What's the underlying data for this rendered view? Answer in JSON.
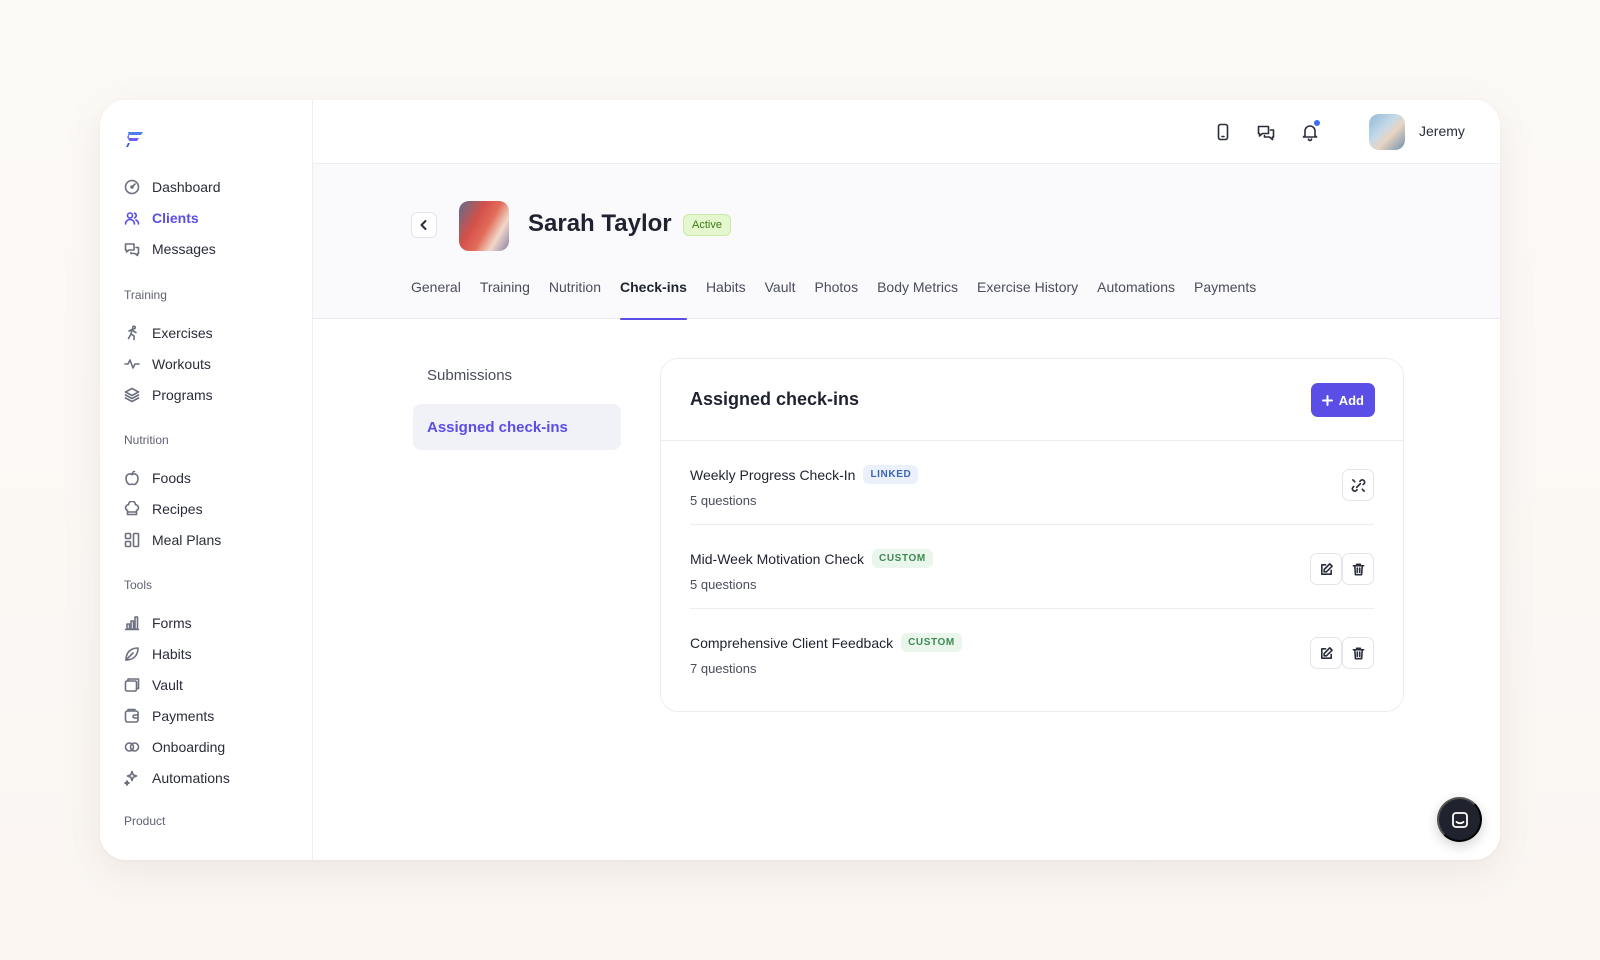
{
  "sidebar": {
    "main": [
      {
        "label": "Dashboard",
        "icon": "dashboard-icon"
      },
      {
        "label": "Clients",
        "icon": "users-icon",
        "active": true
      },
      {
        "label": "Messages",
        "icon": "messages-icon"
      }
    ],
    "sections": [
      {
        "title": "Training",
        "items": [
          {
            "label": "Exercises",
            "icon": "running-icon"
          },
          {
            "label": "Workouts",
            "icon": "activity-icon"
          },
          {
            "label": "Programs",
            "icon": "layers-icon"
          }
        ]
      },
      {
        "title": "Nutrition",
        "items": [
          {
            "label": "Foods",
            "icon": "apple-icon"
          },
          {
            "label": "Recipes",
            "icon": "chef-hat-icon"
          },
          {
            "label": "Meal Plans",
            "icon": "grid-icon"
          }
        ]
      },
      {
        "title": "Tools",
        "items": [
          {
            "label": "Forms",
            "icon": "bar-chart-icon"
          },
          {
            "label": "Habits",
            "icon": "leaf-icon"
          },
          {
            "label": "Vault",
            "icon": "folder-icon"
          },
          {
            "label": "Payments",
            "icon": "wallet-icon"
          },
          {
            "label": "Onboarding",
            "icon": "link-icon"
          },
          {
            "label": "Automations",
            "icon": "sparkle-icon"
          }
        ]
      },
      {
        "title": "Product",
        "items": []
      }
    ]
  },
  "topbar": {
    "user_name": "Jeremy",
    "icons": [
      "mobile-icon",
      "chat-bubbles-icon",
      "bell-icon"
    ],
    "has_notification": true
  },
  "client": {
    "name": "Sarah Taylor",
    "status": "Active"
  },
  "tabs": [
    "General",
    "Training",
    "Nutrition",
    "Check-ins",
    "Habits",
    "Vault",
    "Photos",
    "Body Metrics",
    "Exercise History",
    "Automations",
    "Payments"
  ],
  "active_tab": "Check-ins",
  "subnav": [
    {
      "label": "Submissions",
      "active": false
    },
    {
      "label": "Assigned check-ins",
      "active": true
    }
  ],
  "card": {
    "title": "Assigned check-ins",
    "add_label": "Add",
    "items": [
      {
        "title": "Weekly Progress Check-In",
        "tag": "LINKED",
        "tag_type": "linked",
        "subtitle": "5 questions",
        "actions": [
          "unlink"
        ]
      },
      {
        "title": "Mid-Week Motivation Check",
        "tag": "CUSTOM",
        "tag_type": "custom",
        "subtitle": "5 questions",
        "actions": [
          "edit",
          "delete"
        ]
      },
      {
        "title": "Comprehensive Client Feedback",
        "tag": "CUSTOM",
        "tag_type": "custom",
        "subtitle": "7 questions",
        "actions": [
          "edit",
          "delete"
        ]
      }
    ]
  },
  "colors": {
    "accent": "#5b4ee6",
    "status_bg": "#e4f7cf",
    "status_text": "#3d7a12",
    "linked_bg": "#eaf1fb",
    "custom_bg": "#eaf5ec"
  }
}
